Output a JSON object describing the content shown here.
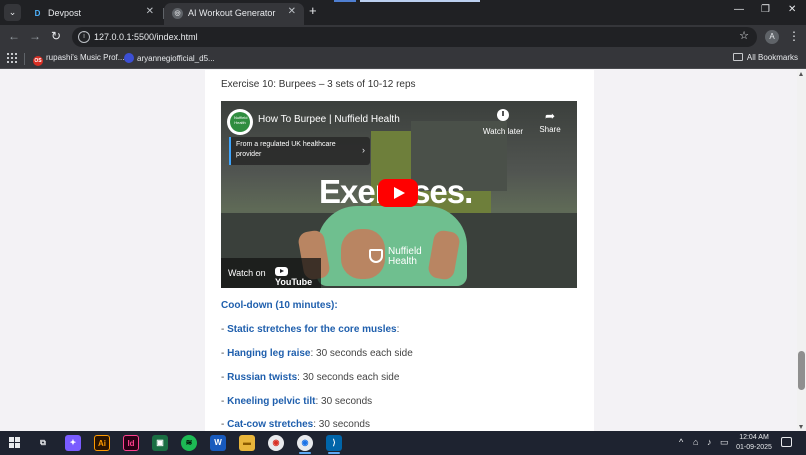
{
  "browser": {
    "tabs": [
      {
        "title": "Devpost",
        "favicon": "D",
        "active": false
      },
      {
        "title": "AI Workout Generator",
        "favicon": "◎",
        "active": true
      }
    ],
    "new_tab": "+",
    "tab_search": "⌄",
    "window_controls": {
      "minimize": "—",
      "restore": "❐",
      "close": "✕"
    },
    "url": "127.0.0.1:5500/index.html",
    "profile_initial": "A",
    "bookmarks": [
      {
        "label": "rupashi's Music Prof...",
        "icon_text": "OS",
        "color": "#d93025"
      },
      {
        "label": "aryannegiofficial_d5...",
        "icon_text": "",
        "color": "#3c4fd4"
      }
    ],
    "all_bookmarks": "All Bookmarks"
  },
  "page": {
    "exercise_title": "Exercise 10: Burpees – 3 sets of 10-12 reps",
    "video": {
      "title": "How To Burpee | Nuffield Health",
      "channel_logo_text": "Nuffield Health",
      "watch_later": "Watch later",
      "share": "Share",
      "info_card": "From a regulated UK healthcare provider",
      "overlay_word": "Exercises.",
      "brand": "Nuffield Health",
      "watch_on": "Watch on",
      "youtube": "YouTube"
    },
    "cooldown_heading": "Cool-down (10 minutes):",
    "items": [
      {
        "prefix": "- ",
        "name": "Static stretches for the core musles",
        "detail": ":"
      },
      {
        "prefix": "- ",
        "name": "Hanging leg raise",
        "detail": ": 30 seconds each side"
      },
      {
        "prefix": "- ",
        "name": "Russian twists",
        "detail": ": 30 seconds each side"
      },
      {
        "prefix": "- ",
        "name": "Kneeling pelvic tilt",
        "detail": ": 30 seconds"
      },
      {
        "prefix": "- ",
        "name": "Cat-cow stretches",
        "detail": ": 30 seconds"
      }
    ]
  },
  "taskbar": {
    "icons": [
      {
        "name": "task-view",
        "text": "⧉",
        "bg": "transparent",
        "fg": "#e8eaed"
      },
      {
        "name": "copilot",
        "text": "✦",
        "bg": "#7a5cff",
        "fg": "#ffffff"
      },
      {
        "name": "illustrator",
        "text": "Ai",
        "bg": "#2b1400",
        "fg": "#ff9a00"
      },
      {
        "name": "indesign",
        "text": "Id",
        "bg": "#2b0016",
        "fg": "#ff3f8e"
      },
      {
        "name": "photos",
        "text": "▣",
        "bg": "#1a6e43",
        "fg": "#ffffff"
      },
      {
        "name": "spotify",
        "text": "≋",
        "bg": "#1db954",
        "fg": "#000000"
      },
      {
        "name": "word",
        "text": "W",
        "bg": "#185abd",
        "fg": "#ffffff"
      },
      {
        "name": "file-explorer",
        "text": "▬",
        "bg": "#e8b53a",
        "fg": "#8a5a00"
      },
      {
        "name": "chrome",
        "text": "◉",
        "bg": "#e8eaed",
        "fg": "#d93025"
      },
      {
        "name": "chrome-profile",
        "text": "◉",
        "bg": "#e8eaed",
        "fg": "#1a73e8"
      },
      {
        "name": "vscode",
        "text": "⟩",
        "bg": "#0065a9",
        "fg": "#ffffff"
      }
    ],
    "tray": {
      "chevron": "^",
      "network": "⌂",
      "volume": "♪",
      "battery": "▭"
    },
    "time": "12:04 AM",
    "date": "01-09-2025"
  }
}
